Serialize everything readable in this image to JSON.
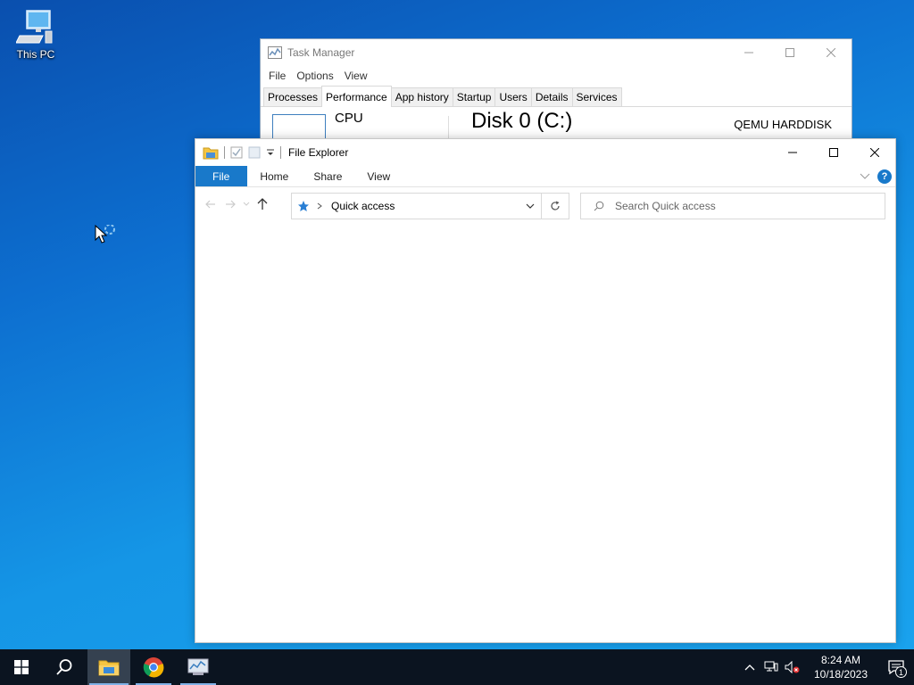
{
  "desktop": {
    "icons": [
      {
        "label": "This PC",
        "icon": "computer-icon"
      }
    ]
  },
  "task_manager": {
    "title": "Task Manager",
    "menu": [
      "File",
      "Options",
      "View"
    ],
    "tabs": [
      "Processes",
      "Performance",
      "App history",
      "Startup",
      "Users",
      "Details",
      "Services"
    ],
    "active_tab": "Performance",
    "side_item": "CPU",
    "main_title": "Disk 0 (C:)",
    "main_subtitle": "QEMU HARDDISK"
  },
  "explorer": {
    "title": "File Explorer",
    "ribbon_tabs": [
      "File",
      "Home",
      "Share",
      "View"
    ],
    "address": {
      "location": "Quick access",
      "icon": "quick-access-star-icon"
    },
    "search": {
      "placeholder": "Search Quick access"
    }
  },
  "taskbar": {
    "apps": [
      "start-icon",
      "search-icon",
      "file-explorer-icon",
      "chrome-icon",
      "task-manager-icon"
    ],
    "clock": {
      "time": "8:24 AM",
      "date": "10/18/2023"
    },
    "notification_count": "1"
  },
  "colors": {
    "accent": "#1979ca",
    "taskbar": "#0b1420",
    "desktop": "#1596e6"
  }
}
